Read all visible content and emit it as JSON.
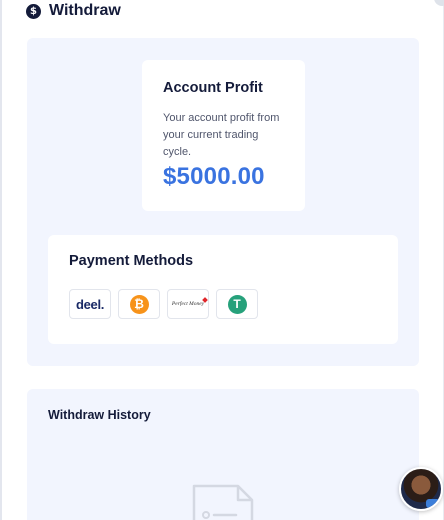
{
  "header": {
    "title": "Withdraw",
    "icon": "dollar-circle-icon"
  },
  "profit": {
    "title": "Account Profit",
    "description": "Your account profit from your current trading cycle.",
    "amount": "$5000.00",
    "amount_color": "#3a73e0"
  },
  "payment_methods": {
    "title": "Payment Methods",
    "items": [
      {
        "name": "deel",
        "label": "deel."
      },
      {
        "name": "bitcoin",
        "symbol": "₿"
      },
      {
        "name": "perfect-money",
        "label": "Perfect Money"
      },
      {
        "name": "tether",
        "symbol": "T"
      }
    ]
  },
  "history": {
    "title": "Withdraw History"
  },
  "colors": {
    "panel_bg": "#f2f5fe",
    "text_dark": "#141b3a",
    "accent": "#3a73e0"
  }
}
